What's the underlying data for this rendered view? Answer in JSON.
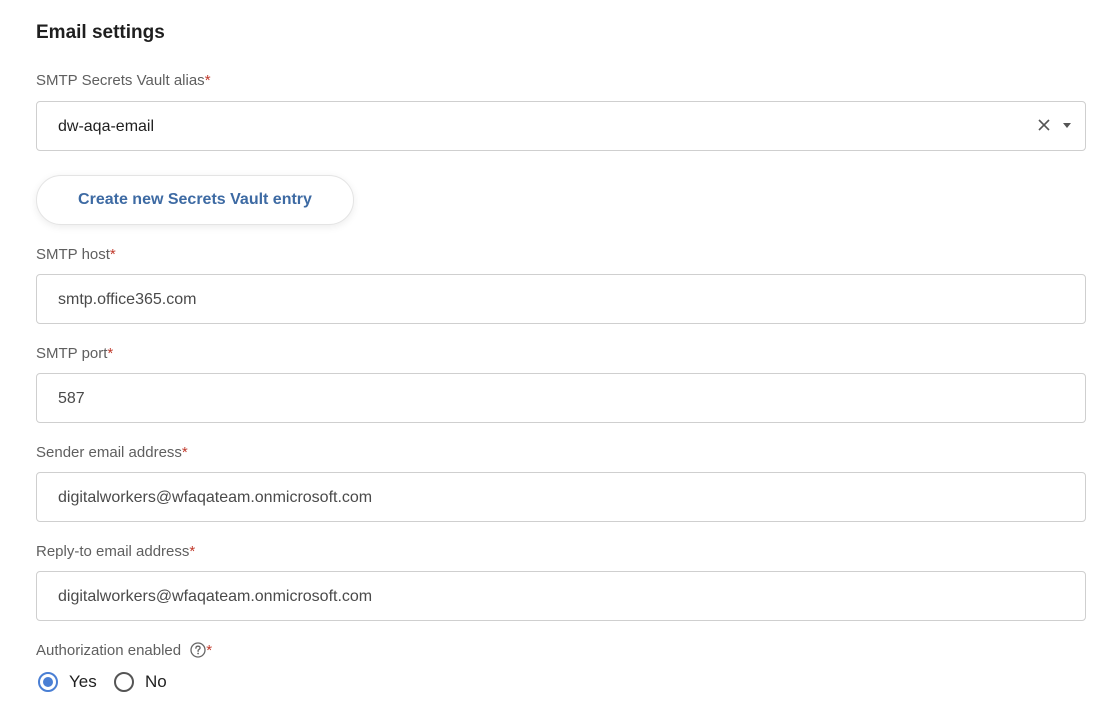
{
  "section": {
    "title": "Email settings"
  },
  "smtp_alias": {
    "label": "SMTP Secrets Vault alias",
    "required_mark": "*",
    "value": "dw-aqa-email"
  },
  "create_button": {
    "label": "Create new Secrets Vault entry"
  },
  "smtp_host": {
    "label": "SMTP host",
    "required_mark": "*",
    "value": "smtp.office365.com"
  },
  "smtp_port": {
    "label": "SMTP port",
    "required_mark": "*",
    "value": "587"
  },
  "sender_email": {
    "label": "Sender email address",
    "required_mark": "*",
    "value": "digitalworkers@wfaqateam.onmicrosoft.com"
  },
  "reply_to_email": {
    "label": "Reply-to email address",
    "required_mark": "*",
    "value": "digitalworkers@wfaqateam.onmicrosoft.com"
  },
  "authorization": {
    "label": "Authorization enabled",
    "required_mark": "*",
    "options": [
      {
        "label": "Yes",
        "checked": true
      },
      {
        "label": "No",
        "checked": false
      }
    ]
  },
  "icons": {
    "clear": "close-icon",
    "dropdown": "chevron-down-icon",
    "help": "question-circle-icon"
  },
  "colors": {
    "accent": "#4a7fd4",
    "button_text": "#3d6aa3",
    "required": "#c0392b"
  }
}
